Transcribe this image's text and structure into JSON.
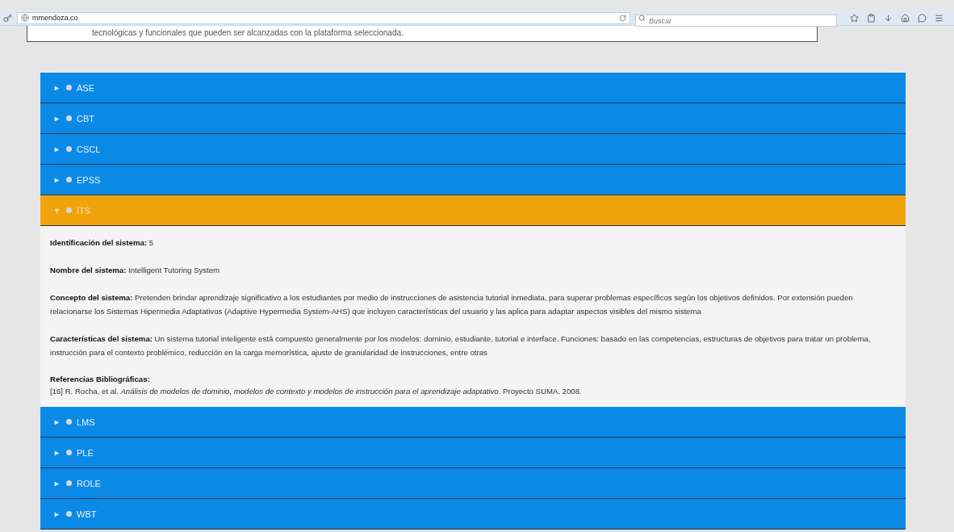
{
  "browser": {
    "url": "mmendoza.co",
    "search": {
      "placeholder": "Buscar"
    }
  },
  "intro_text": "tecnológicas y funcionales que pueden ser alcanzadas con la plataforma seleccionada.",
  "accordion": [
    {
      "marker": "►",
      "label": "ASE",
      "expanded": false
    },
    {
      "marker": "►",
      "label": "CBT",
      "expanded": false
    },
    {
      "marker": "►",
      "label": "CSCL",
      "expanded": false
    },
    {
      "marker": "►",
      "label": "EPSS",
      "expanded": false
    },
    {
      "marker": "▼",
      "label": "ITS",
      "expanded": true,
      "fields": [
        {
          "label": "Identificación del sistema:",
          "value": "5"
        },
        {
          "label": "Nombre del sistema:",
          "value": "Intelligent Tutoring System"
        },
        {
          "label": "Concepto del sistema:",
          "value": "Pretenden brindar aprendizaje significativo a los estudiantes por medio de instrucciones de asistencia tutorial inmediata, para superar problemas específicos según los objetivos definidos. Por extensión pueden relacionarse los Sistemas Hipermedia Adaptativos (Adaptive Hypermedia System-AHS) que incluyen características del usuario y las aplica para adaptar aspectos visibles del mismo sistema"
        },
        {
          "label": "Características del sistema:",
          "value": "Un sistema tutorial inteligente está compuesto generalmente por los modelos: dominio, estudiante, tutorial e interface. Funciones: basado en las competencias, estructuras de objetivos para tratar un problema, instrucción para el contexto problémico, reducción en la carga memorística, ajuste de granularidad de instrucciones, entre otras"
        }
      ],
      "references": {
        "label": "Referencias Bibliográficas:",
        "text": "[16] R. Rocha, et al. *Análisis de modelos de dominio, modelos de contexto y modelos de instrucción para el aprendizaje adaptativo*. Proyecto SUMA. 2008."
      }
    },
    {
      "marker": "►",
      "label": "LMS",
      "expanded": false
    },
    {
      "marker": "►",
      "label": "PLE",
      "expanded": false
    },
    {
      "marker": "►",
      "label": "ROLE",
      "expanded": false
    },
    {
      "marker": "►",
      "label": "WBT",
      "expanded": false
    }
  ]
}
